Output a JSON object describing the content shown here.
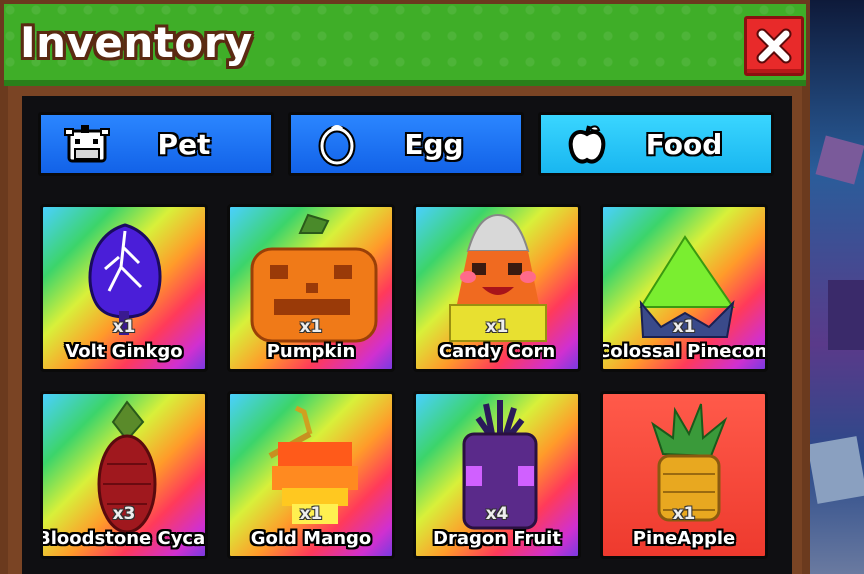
{
  "window": {
    "title": "Inventory",
    "close_icon": "close-x-icon"
  },
  "tabs": [
    {
      "label": "Pet",
      "icon": "pet-cow-icon",
      "active": false
    },
    {
      "label": "Egg",
      "icon": "egg-icon",
      "active": false
    },
    {
      "label": "Food",
      "icon": "apple-icon",
      "active": true
    }
  ],
  "items": [
    {
      "name": "Volt Ginkgo",
      "qty": "x1",
      "icon": "volt-ginkgo-leaf-icon"
    },
    {
      "name": "Pumpkin",
      "qty": "x1",
      "icon": "pumpkin-icon"
    },
    {
      "name": "Candy Corn",
      "qty": "x1",
      "icon": "candy-corn-icon"
    },
    {
      "name": "Colossal Pinecone",
      "qty": "x1",
      "icon": "pinecone-icon"
    },
    {
      "name": "Bloodstone Cycad",
      "qty": "x3",
      "icon": "cycad-fruit-icon"
    },
    {
      "name": "Gold Mango",
      "qty": "x1",
      "icon": "mango-icon"
    },
    {
      "name": "Dragon Fruit",
      "qty": "x4",
      "icon": "dragon-fruit-icon"
    },
    {
      "name": "PineApple",
      "qty": "x1",
      "icon": "pineapple-icon"
    }
  ],
  "colors": {
    "titlebar": "#3fae28",
    "frame": "#6b3a1e",
    "tab": "#1262e8",
    "tab_active": "#19b6f0",
    "close": "#e82a2a",
    "pineapple_card": "#ee3a2e"
  }
}
